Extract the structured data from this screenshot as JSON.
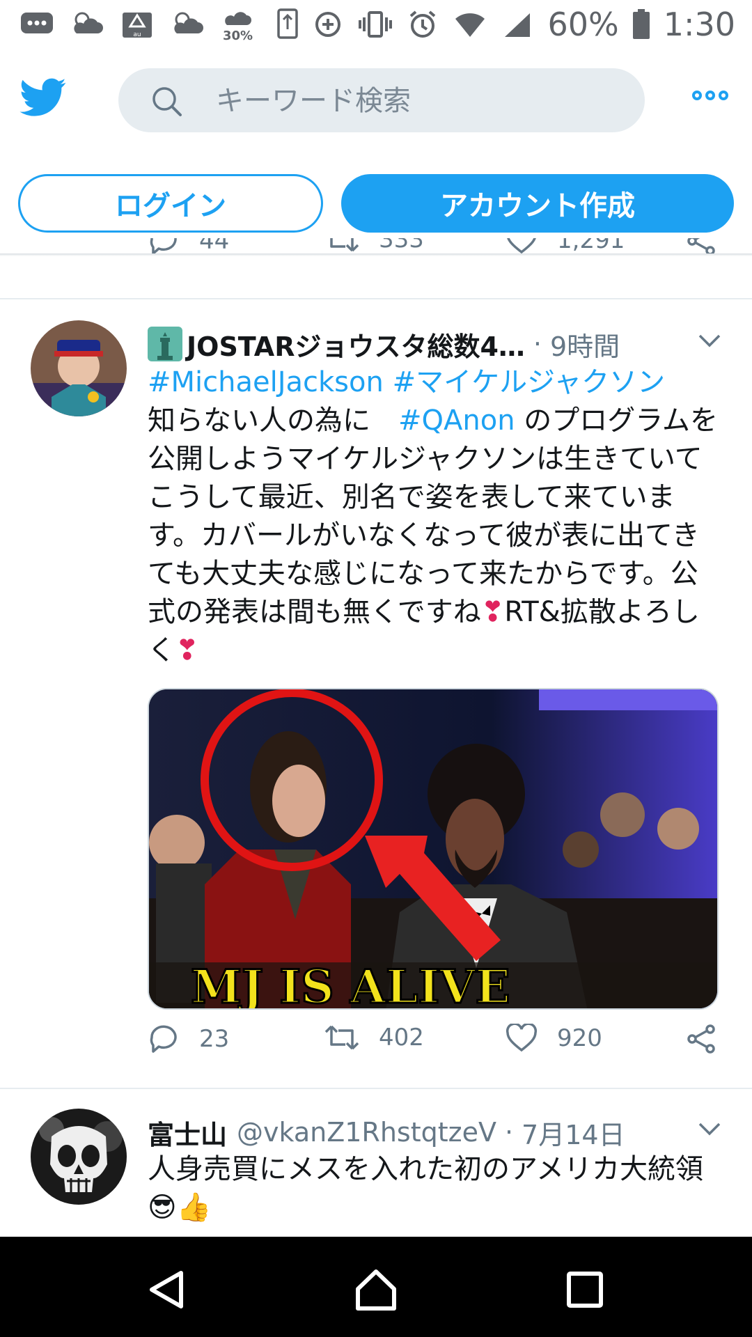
{
  "status_bar": {
    "weather_percent": "30%",
    "battery_percent": "60%",
    "time": "1:30"
  },
  "header": {
    "search_placeholder": "キーワード検索"
  },
  "auth": {
    "login_label": "ログイン",
    "signup_label": "アカウント作成"
  },
  "previous_tweet": {
    "replies": "44",
    "retweets": "333",
    "likes": "1,291"
  },
  "tweets": [
    {
      "name": "JOSTARジョウスタ総数4…",
      "time": "9時間",
      "hashtags": "#MichaelJackson #マイケルジャクソン",
      "text_a": "知らない人の為に　",
      "qanon": "#QAnon",
      "text_b": " のプログラムを公開しようマイケルジャクソンは生きていてこうして最近、別名で姿を表して来ています。カバールがいなくなって彼が表に出てきても大丈夫な感じになって来たからです。公式の発表は間も無くですね",
      "heart1": "❣",
      "text_c": "RT&拡散よろしく",
      "heart2": "❣",
      "media_caption": "MJ IS ALIVE",
      "replies": "23",
      "retweets": "402",
      "likes": "920"
    },
    {
      "name": "富士山",
      "handle": "@vkanZ1RhstqtzeV",
      "time": "7月14日",
      "text": "人身売買にメスを入れた初のアメリカ大統領",
      "emoji": "😎👍"
    }
  ],
  "colors": {
    "accent": "#1da1f2",
    "text": "#14171a",
    "muted": "#657786",
    "divider": "#e6ecf0"
  }
}
